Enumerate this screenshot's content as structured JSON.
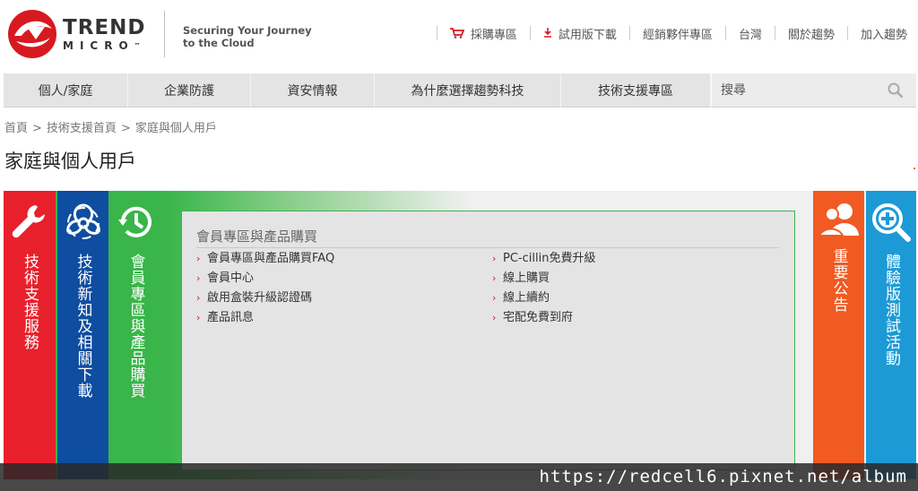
{
  "header": {
    "brand_line1": "TREND",
    "brand_line2": "MICRO",
    "trademark": "™",
    "tagline_line1": "Securing Your Journey",
    "tagline_line2": "to the Cloud",
    "top_links": [
      {
        "label": "採購專區",
        "icon": "cart-icon"
      },
      {
        "label": "試用版下載",
        "icon": "download-icon"
      },
      {
        "label": "經銷夥伴專區"
      },
      {
        "label": "台灣"
      },
      {
        "label": "關於趨勢"
      },
      {
        "label": "加入趨勢"
      }
    ]
  },
  "nav": {
    "items": [
      "個人/家庭",
      "企業防護",
      "資安情報",
      "為什麼選擇趨勢科技",
      "技術支援專區"
    ],
    "search_placeholder": "搜尋"
  },
  "breadcrumb": [
    "首頁",
    ">",
    "技術支援首頁",
    ">",
    "家庭與個人用戶"
  ],
  "page_title": "家庭與個人用戶",
  "tiles": {
    "support": "技術支援服務",
    "news": "技術新知及相關下載",
    "member": "會員專區與產品購買",
    "notice": "重要公告",
    "trial": "體驗版測試活動"
  },
  "panel": {
    "heading": "會員專區與產品購買",
    "left_links": [
      "會員專區與產品購買FAQ",
      "會員中心",
      "啟用盒裝升級認證碼",
      "產品訊息"
    ],
    "right_links": [
      "PC-cillin免費升級",
      "線上購買",
      "線上續約",
      "宅配免費到府"
    ]
  },
  "watermark": "https://redcell6.pixnet.net/album",
  "colors": {
    "brand_red": "#d71920",
    "tile_red": "#e8202b",
    "tile_blue": "#0f4da0",
    "tile_green": "#39b54a",
    "tile_orange": "#f15a22",
    "tile_cyan": "#1c9ad6"
  }
}
